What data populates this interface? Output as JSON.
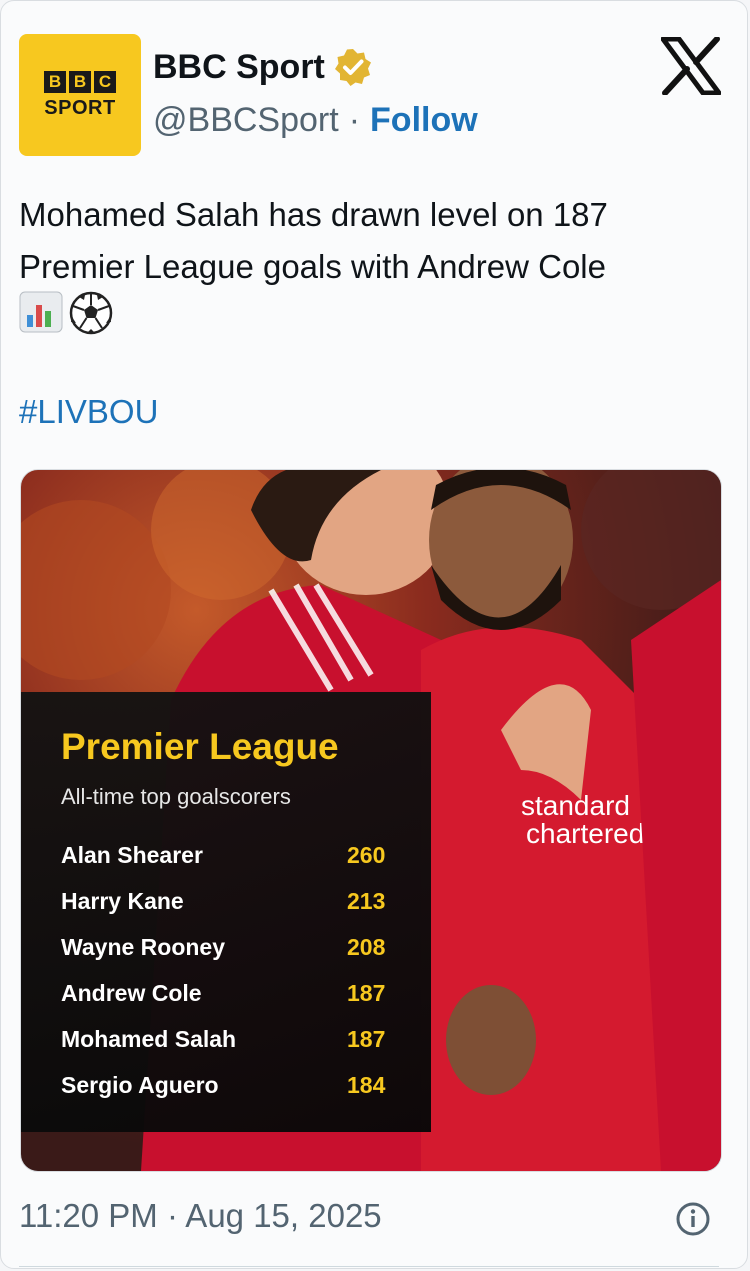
{
  "author": {
    "name": "BBC Sport",
    "handle": "@BBCSport",
    "separator": "·",
    "follow_label": "Follow",
    "avatar_letters": [
      "B",
      "B",
      "C"
    ],
    "avatar_word": "SPORT",
    "verified_icon": "verified-badge-icon",
    "platform_icon": "x-logo-icon"
  },
  "tweet": {
    "text": "Mohamed Salah has drawn level on 187 Premier League goals with Andrew Cole",
    "emojis": [
      "bar-chart-emoji",
      "soccer-ball-emoji"
    ],
    "hashtag": "#LIVBOU"
  },
  "media": {
    "title": "Premier League",
    "subtitle": "All-time top goalscorers",
    "scorers": [
      {
        "name": "Alan Shearer",
        "goals": "260"
      },
      {
        "name": "Harry Kane",
        "goals": "213"
      },
      {
        "name": "Wayne Rooney",
        "goals": "208"
      },
      {
        "name": "Andrew Cole",
        "goals": "187"
      },
      {
        "name": "Mohamed Salah",
        "goals": "187"
      },
      {
        "name": "Sergio Aguero",
        "goals": "184"
      }
    ]
  },
  "footer": {
    "timestamp": "11:20 PM · Aug 15, 2025",
    "info_icon": "info-icon"
  },
  "colors": {
    "brand_yellow": "#f7c81f",
    "link_blue": "#1d72b8",
    "kit_red": "#c8102e"
  }
}
